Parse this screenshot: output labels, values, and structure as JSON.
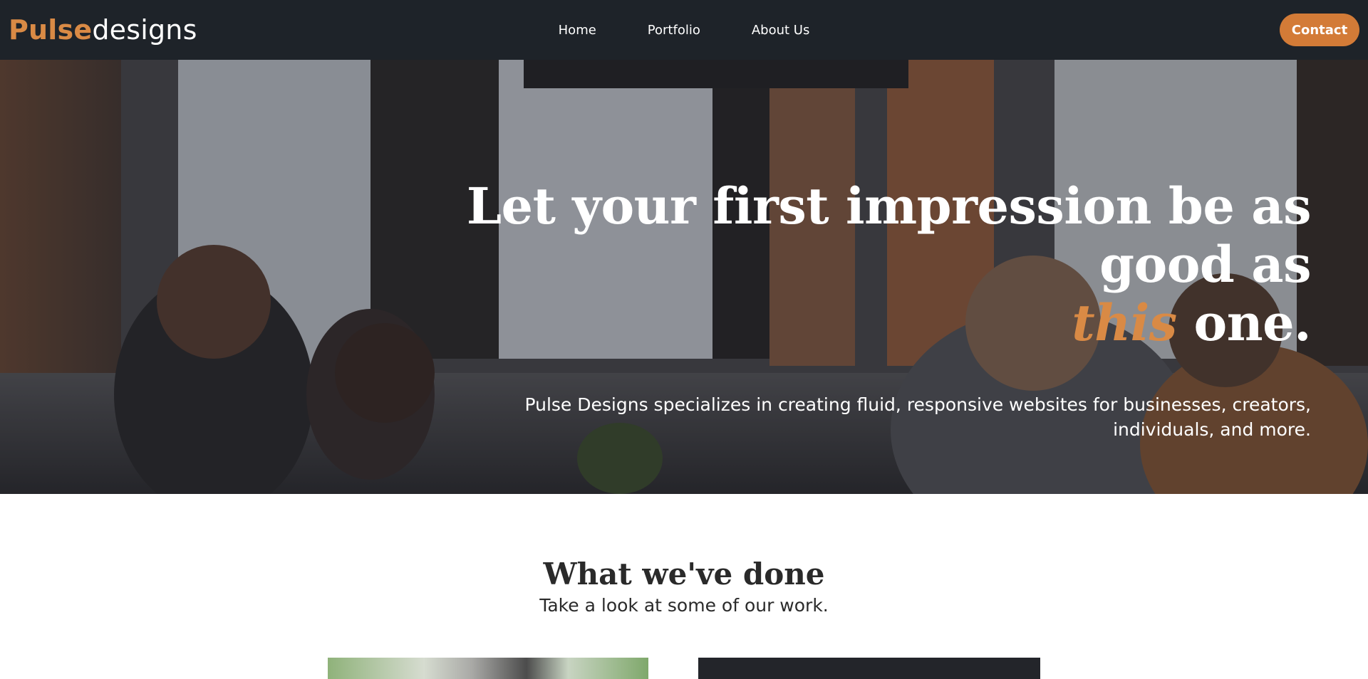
{
  "header": {
    "logo_bold": "Pulse",
    "logo_light": "designs",
    "nav": [
      {
        "label": "Home"
      },
      {
        "label": "Portfolio"
      },
      {
        "label": "About Us"
      }
    ],
    "contact_label": "Contact"
  },
  "hero": {
    "title_line1": "Let your first impression be as good as",
    "title_accent": "this",
    "title_end": " one.",
    "description": "Pulse Designs specializes in creating fluid, responsive websites for businesses, creators, individuals, and more."
  },
  "work": {
    "title": "What we've done",
    "subtitle": "Take a look at some of our work."
  },
  "colors": {
    "header_bg": "#1e2329",
    "accent": "#d98a45",
    "button": "#d37b37"
  }
}
